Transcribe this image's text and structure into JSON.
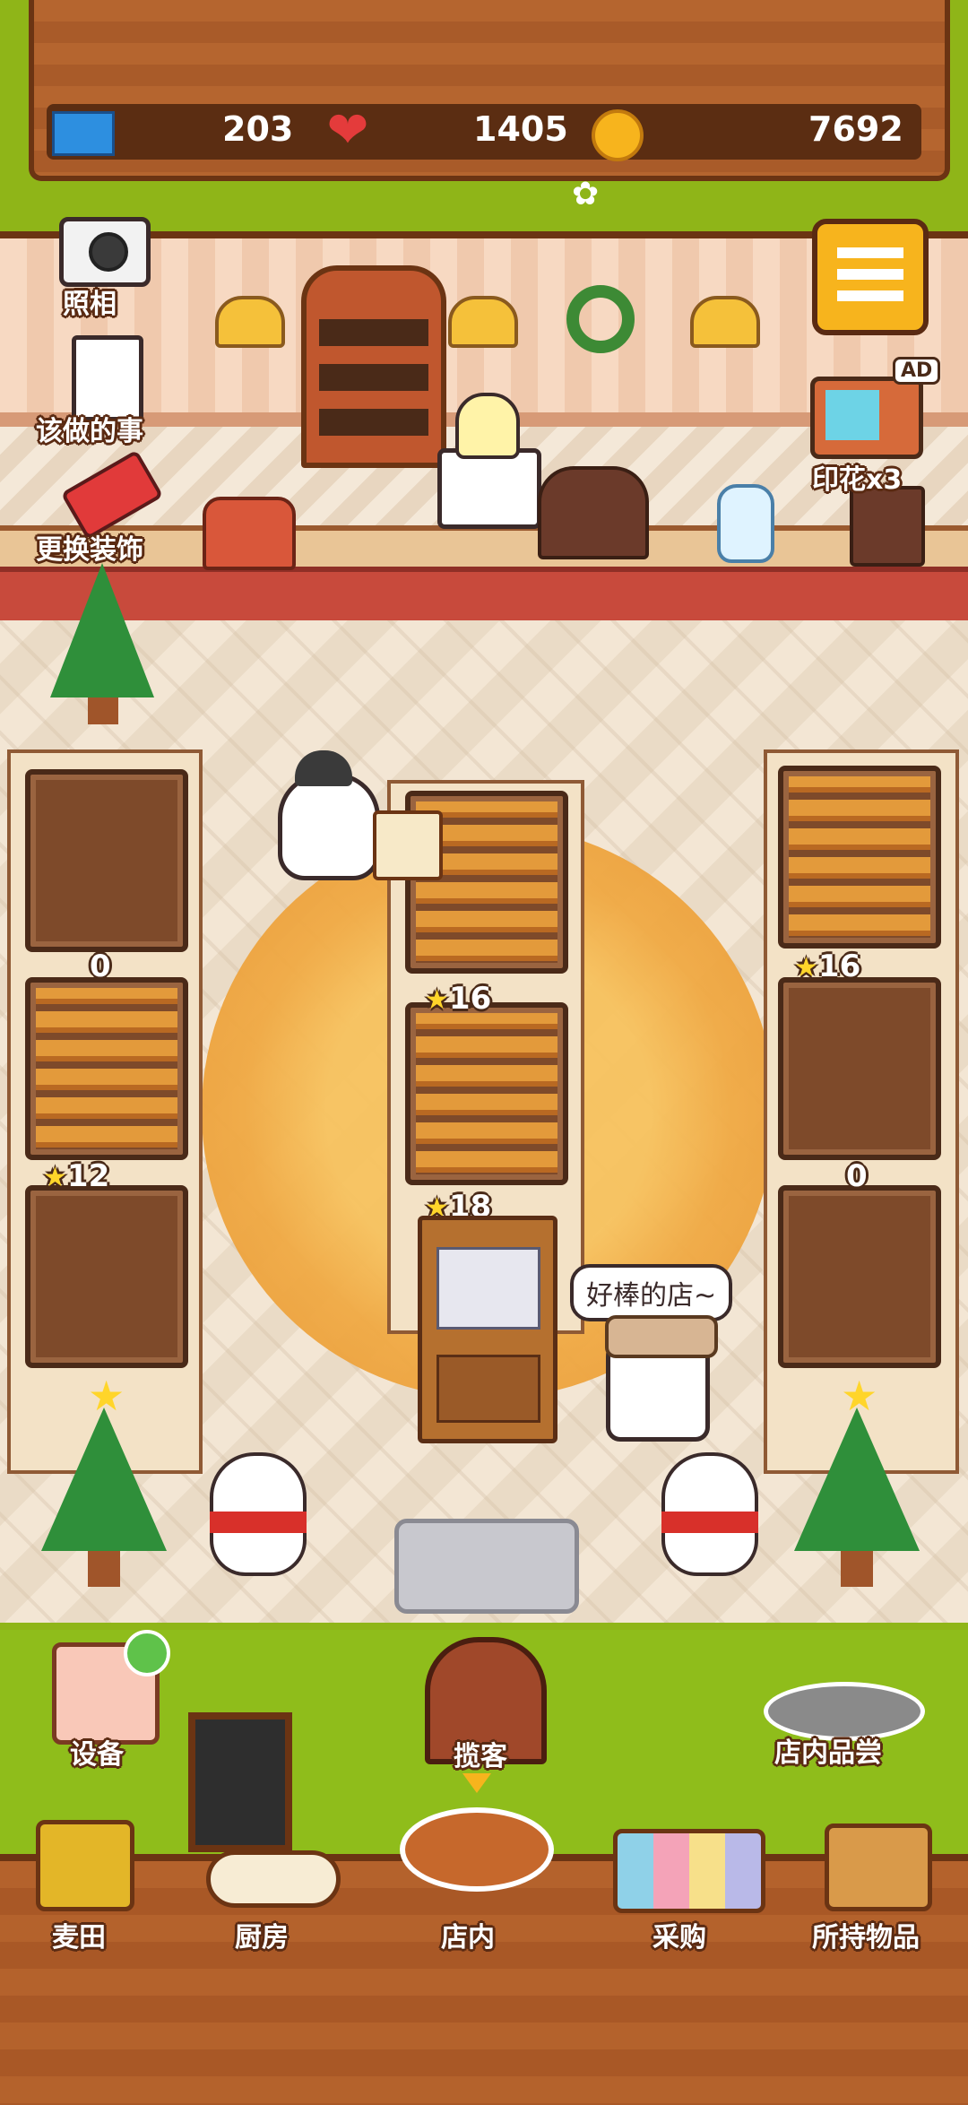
{
  "stats": {
    "tickets": "203",
    "hearts": "1405",
    "coins": "7692"
  },
  "side_menu": {
    "photo": "照相",
    "todo": "该做的事",
    "decorate": "更换装饰"
  },
  "ad_reward": {
    "badge": "AD",
    "label": "印花x3"
  },
  "racks": {
    "left_middle_count": "0",
    "left_bottom_stars": "12",
    "center_middle_stars": "16",
    "center_bottom_stars": "18",
    "right_middle_stars": "16",
    "right_bottom_count": "0"
  },
  "customer_bubble": "好棒的店~",
  "bottom": {
    "equipment": "设备",
    "attract": "揽客",
    "taste": "店内品尝"
  },
  "nav": {
    "wheat_field": "麦田",
    "kitchen": "厨房",
    "shop": "店内",
    "purchase": "采购",
    "inventory": "所持物品"
  },
  "colors": {
    "grass": "#8fb518",
    "wood": "#b4622c",
    "accent_yellow": "#f7b41d"
  }
}
